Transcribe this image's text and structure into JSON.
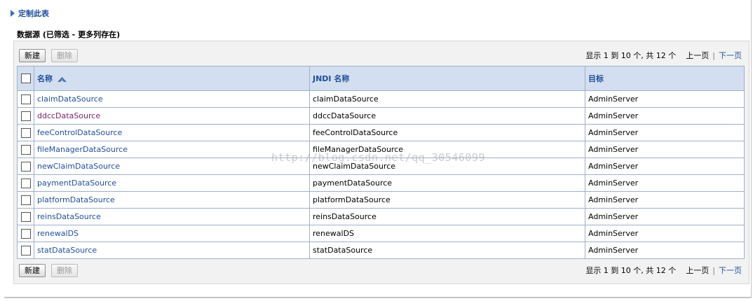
{
  "customize_link": "定制此表",
  "section_title": "数据源 (已筛选 - 更多列存在)",
  "toolbar": {
    "new_label": "新建",
    "delete_label": "删除",
    "pager_text": "显示 1 到 10 个, 共 12 个",
    "prev_label": "上一页",
    "next_label": "下一页"
  },
  "table": {
    "headers": [
      "名称",
      "JNDI 名称",
      "目标"
    ],
    "rows": [
      {
        "name": "claimDataSource",
        "jndi": "claimDataSource",
        "target": "AdminServer"
      },
      {
        "name": "ddccDataSource",
        "jndi": "ddccDataSource",
        "target": "AdminServer"
      },
      {
        "name": "feeControlDataSource",
        "jndi": "feeControlDataSource",
        "target": "AdminServer"
      },
      {
        "name": "fileManagerDataSource",
        "jndi": "fileManagerDataSource",
        "target": "AdminServer"
      },
      {
        "name": "newClaimDataSource",
        "jndi": "newClaimDataSource",
        "target": "AdminServer"
      },
      {
        "name": "paymentDataSource",
        "jndi": "paymentDataSource",
        "target": "AdminServer"
      },
      {
        "name": "platformDataSource",
        "jndi": "platformDataSource",
        "target": "AdminServer"
      },
      {
        "name": "reinsDataSource",
        "jndi": "reinsDataSource",
        "target": "AdminServer"
      },
      {
        "name": "renewalDS",
        "jndi": "renewalDS",
        "target": "AdminServer"
      },
      {
        "name": "statDataSource",
        "jndi": "statDataSource",
        "target": "AdminServer"
      }
    ]
  },
  "watermark": "http://blog.csdn.net/qq_30546099",
  "icons": {
    "customize": "triangle-right-icon",
    "sort": "sort-ascending-icon"
  },
  "colors": {
    "link": "#1f4e9a",
    "visited_link": "#7a1f6e",
    "header_bg": "#d3dff0"
  }
}
